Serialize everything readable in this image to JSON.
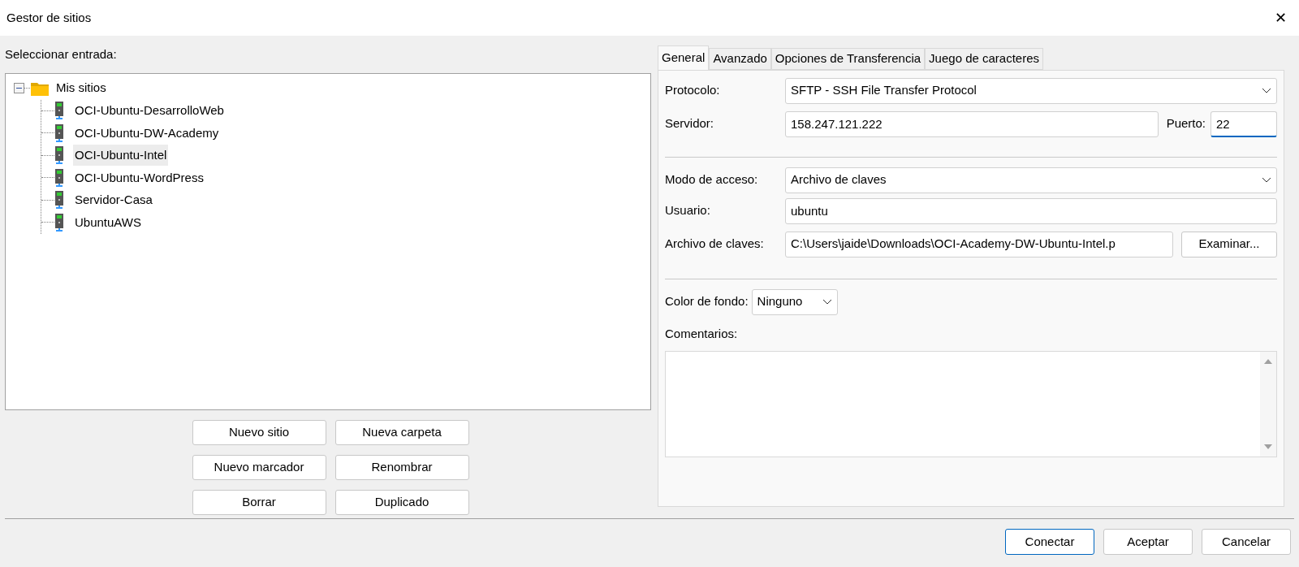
{
  "window": {
    "title": "Gestor de sitios",
    "close": "✕"
  },
  "site_list": {
    "label": "Seleccionar entrada:",
    "tree": {
      "label": "Mis sitios",
      "expanded": true,
      "children": [
        {
          "label": "OCI-Ubuntu-DesarrolloWeb",
          "selected": false
        },
        {
          "label": "OCI-Ubuntu-DW-Academy",
          "selected": false
        },
        {
          "label": "OCI-Ubuntu-Intel",
          "selected": true
        },
        {
          "label": "OCI-Ubuntu-WordPress",
          "selected": false
        },
        {
          "label": "Servidor-Casa",
          "selected": false
        },
        {
          "label": "UbuntuAWS",
          "selected": false
        }
      ]
    },
    "buttons": [
      "Nuevo sitio",
      "Nueva carpeta",
      "Nuevo marcador",
      "Renombrar",
      "Borrar",
      "Duplicado"
    ]
  },
  "tabs": [
    {
      "label": "General",
      "selected": true
    },
    {
      "label": "Avanzado",
      "selected": false
    },
    {
      "label": "Opciones de Transferencia",
      "selected": false
    },
    {
      "label": "Juego de caracteres",
      "selected": false
    }
  ],
  "general": {
    "protocol": {
      "label": "Protocolo:",
      "value": "SFTP - SSH File Transfer Protocol"
    },
    "server": {
      "label": "Servidor:",
      "value": "158.247.121.222"
    },
    "port": {
      "label": "Puerto:",
      "value": "22",
      "focused": true
    },
    "access_mode": {
      "label": "Modo de acceso:",
      "value": "Archivo de claves"
    },
    "user": {
      "label": "Usuario:",
      "value": "ubuntu"
    },
    "key_file": {
      "label": "Archivo de claves:",
      "value": "C:\\Users\\jaide\\Downloads\\OCI-Academy-DW-Ubuntu-Intel.p",
      "button": "Examinar..."
    },
    "background_color": {
      "label": "Color de fondo:",
      "value": "Ninguno"
    },
    "comments": {
      "label": "Comentarios:"
    }
  },
  "footer_buttons": [
    {
      "label": "Conectar",
      "default": true
    },
    {
      "label": "Aceptar",
      "default": false
    },
    {
      "label": "Cancelar",
      "default": false
    }
  ]
}
